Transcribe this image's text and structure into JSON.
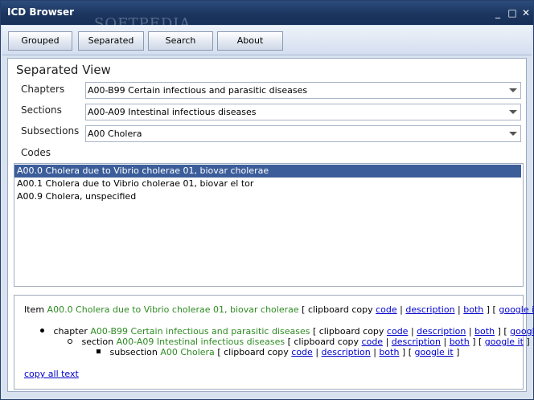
{
  "window": {
    "title": "ICD Browser",
    "watermark": "SOFTPEDIA",
    "minimize_glyph": "_",
    "maximize_glyph": "□",
    "close_glyph": "✕"
  },
  "toolbar": {
    "grouped_label": "Grouped",
    "separated_label": "Separated",
    "search_label": "Search",
    "about_label": "About"
  },
  "view": {
    "title": "Separated View",
    "chapters_label": "Chapters",
    "chapters_value": "A00-B99 Certain infectious and parasitic diseases",
    "sections_label": "Sections",
    "sections_value": "A00-A09 Intestinal infectious diseases",
    "subsections_label": "Subsections",
    "subsections_value": "A00 Cholera",
    "codes_label": "Codes"
  },
  "codes": [
    "A00.0 Cholera due to Vibrio cholerae 01, biovar cholerae",
    "A00.1 Cholera due to Vibrio cholerae 01, biovar el tor",
    "A00.9 Cholera, unspecified"
  ],
  "details": {
    "item_prefix": "Item",
    "item_value": "A00.0 Cholera due to Vibrio cholerae 01, biovar cholerae",
    "chapter_prefix": "chapter",
    "chapter_value": "A00-B99 Certain infectious and parasitic diseases",
    "section_prefix": "section",
    "section_value": "A00-A09 Intestinal infectious diseases",
    "subsection_prefix": "subsection",
    "subsection_value": "A00 Cholera",
    "clipboard_open": "[ clipboard copy",
    "link_code": "code",
    "sep": "|",
    "link_description": "description",
    "link_both": "both",
    "close_open": "] [",
    "link_google": "google it",
    "close_bracket": "]",
    "copy_all": "copy all text"
  },
  "colors": {
    "title_bar": "#1b355e",
    "selection": "#3b5d9a",
    "green_text": "#2e8b23",
    "link": "#0000cc"
  }
}
